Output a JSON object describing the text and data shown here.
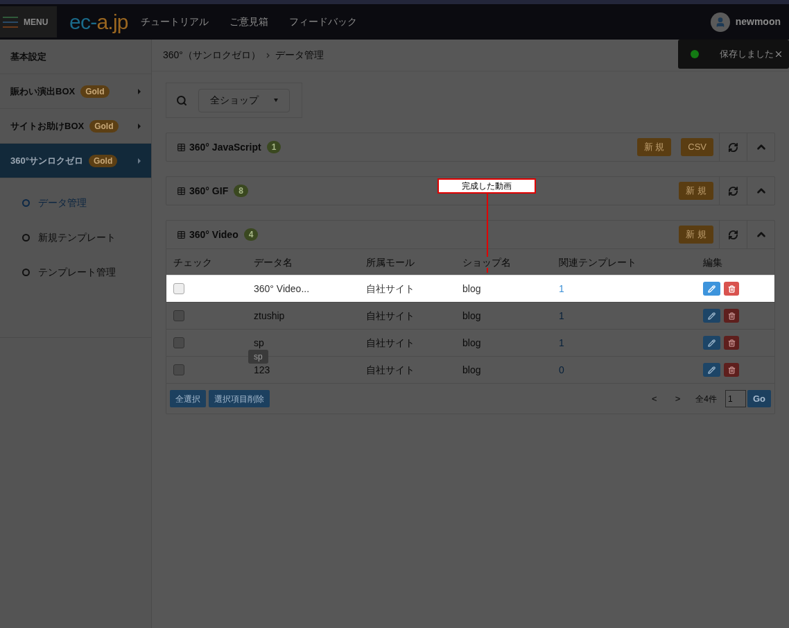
{
  "header": {
    "menu_label": "MENU",
    "logo_left": "ec-",
    "logo_right": "a.jp",
    "nav": [
      "チュートリアル",
      "ご意見箱",
      "フィードバック"
    ],
    "user": "newmoon"
  },
  "toast": {
    "message": "保存しました"
  },
  "sidebar": {
    "items": [
      {
        "label": "基本設定",
        "selected": false
      },
      {
        "label": "賑わい演出BOX",
        "badge": "Gold",
        "selected": false
      },
      {
        "label": "サイトお助けBOX",
        "badge": "Gold",
        "selected": false
      },
      {
        "label": "360°サンロクゼロ",
        "badge": "Gold",
        "selected": true
      }
    ],
    "sub_items": [
      {
        "label": "データ管理",
        "selected": true
      },
      {
        "label": "新規テンプレート",
        "selected": false
      },
      {
        "label": "テンプレート管理",
        "selected": false
      }
    ]
  },
  "breadcrumb": [
    "360°（サンロクゼロ）",
    "データ管理"
  ],
  "filter": {
    "value": "全ショップ"
  },
  "panels": [
    {
      "title": "360° JavaScript",
      "count": "1",
      "buttons": [
        "新 規",
        "CSV"
      ]
    },
    {
      "title": "360° GIF",
      "count": "8",
      "buttons": [
        "新 規"
      ]
    },
    {
      "title": "360° Video",
      "count": "4",
      "buttons": [
        "新 規"
      ],
      "table": {
        "columns": [
          "チェック",
          "データ名",
          "所属モール",
          "ショップ名",
          "関連テンプレート",
          "編集"
        ],
        "rows": [
          {
            "highlighted": true,
            "checked": false,
            "name": "360° Video...",
            "mall": "自社サイト",
            "shop": "blog",
            "templates": "1"
          },
          {
            "highlighted": false,
            "checked": false,
            "name": "ztuship",
            "mall": "自社サイト",
            "shop": "blog",
            "templates": "1"
          },
          {
            "highlighted": false,
            "checked": false,
            "name": "sp",
            "mall": "自社サイト",
            "shop": "blog",
            "templates": "1",
            "tooltip": "sp"
          },
          {
            "highlighted": false,
            "checked": false,
            "name": "123",
            "mall": "自社サイト",
            "shop": "blog",
            "templates": "0"
          }
        ],
        "footer_buttons": [
          "全選択",
          "選択項目削除"
        ],
        "pagination": {
          "prev": "<",
          "next": ">",
          "total": "全4件",
          "page": "1",
          "go": "Go"
        }
      }
    }
  ],
  "callout": {
    "text": "完成した動画"
  }
}
